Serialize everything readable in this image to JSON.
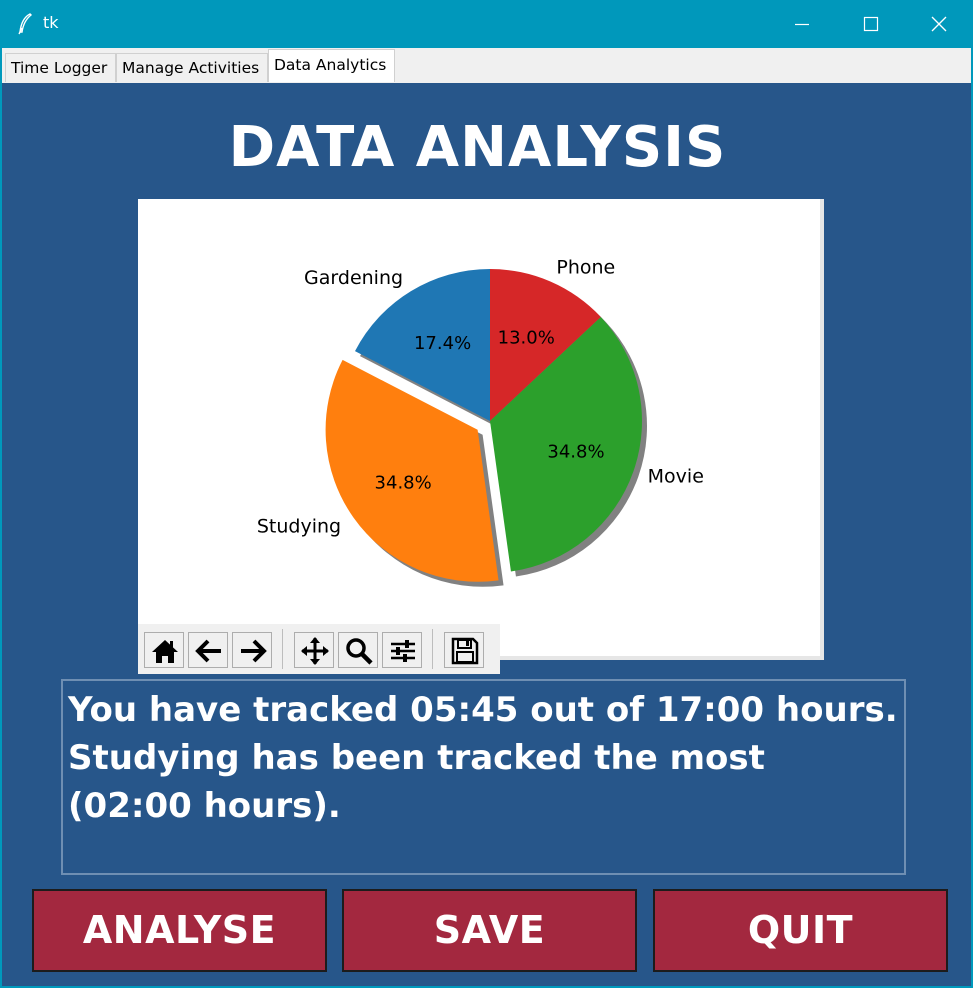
{
  "window": {
    "title": "tk"
  },
  "tabs": [
    {
      "label": "Time Logger",
      "active": false
    },
    {
      "label": "Manage Activities",
      "active": false
    },
    {
      "label": "Data Analytics",
      "active": true
    }
  ],
  "main": {
    "heading": "DATA ANALYSIS",
    "summary": "You have tracked 05:45 out of 17:00 hours.\nStudying has been tracked the most\n(02:00 hours).",
    "buttons": {
      "analyse": "ANALYSE",
      "save": "SAVE",
      "quit": "QUIT"
    }
  },
  "toolbar": {
    "icons": [
      "home-icon",
      "back-arrow-icon",
      "forward-arrow-icon",
      "pan-icon",
      "zoom-icon",
      "configure-subplots-icon",
      "save-figure-icon"
    ]
  },
  "colors": {
    "titlebar": "#0098bb",
    "background": "#27568a",
    "button": "#a3283f",
    "text": "#ffffff"
  },
  "chart_data": {
    "type": "pie",
    "title": "",
    "shadow": true,
    "start_angle": 90,
    "categories": [
      "Phone",
      "Movie",
      "Studying",
      "Gardening"
    ],
    "values": [
      13.0,
      34.8,
      34.8,
      17.4
    ],
    "labels": [
      "13.0%",
      "34.8%",
      "34.8%",
      "17.4%"
    ],
    "explode": [
      0,
      0,
      0.1,
      0
    ],
    "colors": [
      "#d62728",
      "#2ca02c",
      "#ff7f0e",
      "#1f77b4"
    ]
  }
}
